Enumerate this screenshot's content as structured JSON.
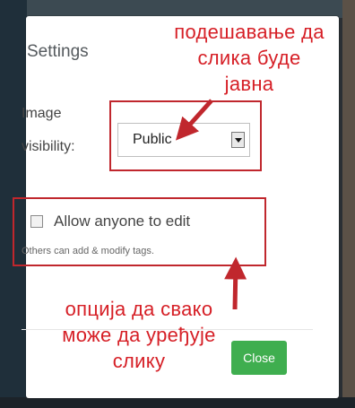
{
  "dialog": {
    "title": "Settings",
    "image_visibility": {
      "label_line1": "Image",
      "label_line2": "visibility:",
      "selected": "Public"
    },
    "allow_edit": {
      "label": "Allow anyone to edit",
      "help": "Others can add & modify tags.",
      "checked": false
    },
    "close_label": "Close"
  },
  "annotations": {
    "top_lines": [
      "подешавање да",
      "слика буде",
      "јавна"
    ],
    "bottom_lines": [
      "опција да свако",
      "може да уређује",
      "слику"
    ]
  },
  "colors": {
    "annotation": "#d61f26",
    "close_button": "#3fae4f"
  }
}
